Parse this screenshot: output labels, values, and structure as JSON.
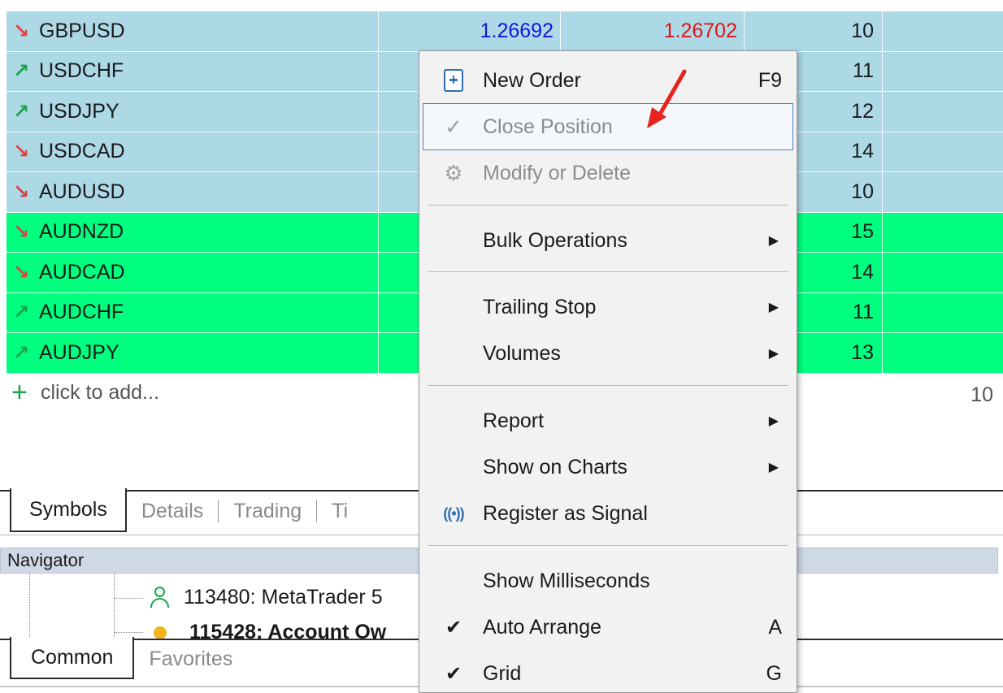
{
  "market_watch": {
    "rows": [
      {
        "direction": "down",
        "symbol": "GBPUSD",
        "bid": "1.26692",
        "ask": "1.26702",
        "spread": "10",
        "color": "blue"
      },
      {
        "direction": "up",
        "symbol": "USDCHF",
        "bid": "",
        "ask": "",
        "spread": "11",
        "color": "blue"
      },
      {
        "direction": "up",
        "symbol": "USDJPY",
        "bid": "",
        "ask": "",
        "spread": "12",
        "color": "blue"
      },
      {
        "direction": "down",
        "symbol": "USDCAD",
        "bid": "",
        "ask": "",
        "spread": "14",
        "color": "blue"
      },
      {
        "direction": "down",
        "symbol": "AUDUSD",
        "bid": "",
        "ask": "",
        "spread": "10",
        "color": "blue"
      },
      {
        "direction": "down",
        "symbol": "AUDNZD",
        "bid": "",
        "ask": "",
        "spread": "15",
        "color": "green"
      },
      {
        "direction": "down",
        "symbol": "AUDCAD",
        "bid": "",
        "ask": "",
        "spread": "14",
        "color": "green"
      },
      {
        "direction": "up",
        "symbol": "AUDCHF",
        "bid": "",
        "ask": "",
        "spread": "11",
        "color": "green"
      },
      {
        "direction": "up",
        "symbol": "AUDJPY",
        "bid": "",
        "ask": "",
        "spread": "13",
        "color": "green"
      }
    ],
    "add_label": "click to add...",
    "total_count": "10"
  },
  "tabs_top": {
    "items": [
      "Symbols",
      "Details",
      "Trading",
      "Ti"
    ],
    "active": "Symbols"
  },
  "navigator": {
    "title": "Navigator",
    "accounts": [
      {
        "label": "113480: MetaTrader 5",
        "icon": "person-icon",
        "bold": false
      },
      {
        "label": "115428: Account Ow",
        "icon": "coin-icon",
        "bold": true
      }
    ]
  },
  "tabs_bottom": {
    "items": [
      "Common",
      "Favorites"
    ],
    "active": "Common"
  },
  "context_menu": {
    "items": [
      {
        "label": "New Order",
        "shortcut": "F9",
        "icon": "new-order-icon",
        "enabled": true
      },
      {
        "label": "Close Position",
        "icon": "checkmark-icon",
        "enabled": false,
        "hovered": true
      },
      {
        "label": "Modify or Delete",
        "icon": "gear-icon",
        "enabled": false
      },
      {
        "label": "Bulk Operations",
        "submenu": true
      },
      {
        "label": "Trailing Stop",
        "submenu": true
      },
      {
        "label": "Volumes",
        "submenu": true
      },
      {
        "label": "Report",
        "submenu": true
      },
      {
        "label": "Show on Charts",
        "submenu": true
      },
      {
        "label": "Register as Signal",
        "icon": "signal-icon"
      },
      {
        "label": "Show Milliseconds"
      },
      {
        "label": "Auto Arrange",
        "shortcut": "A",
        "checked": true
      },
      {
        "label": "Grid",
        "shortcut": "G",
        "checked": true
      }
    ]
  },
  "colors": {
    "row_blue": "#add8e6",
    "row_green": "#00ff7f",
    "bid_text": "#1414e0",
    "ask_text": "#e01414",
    "arrow_down": "#e04040",
    "arrow_up": "#1aa34a",
    "annotation_arrow": "#e8231e"
  }
}
